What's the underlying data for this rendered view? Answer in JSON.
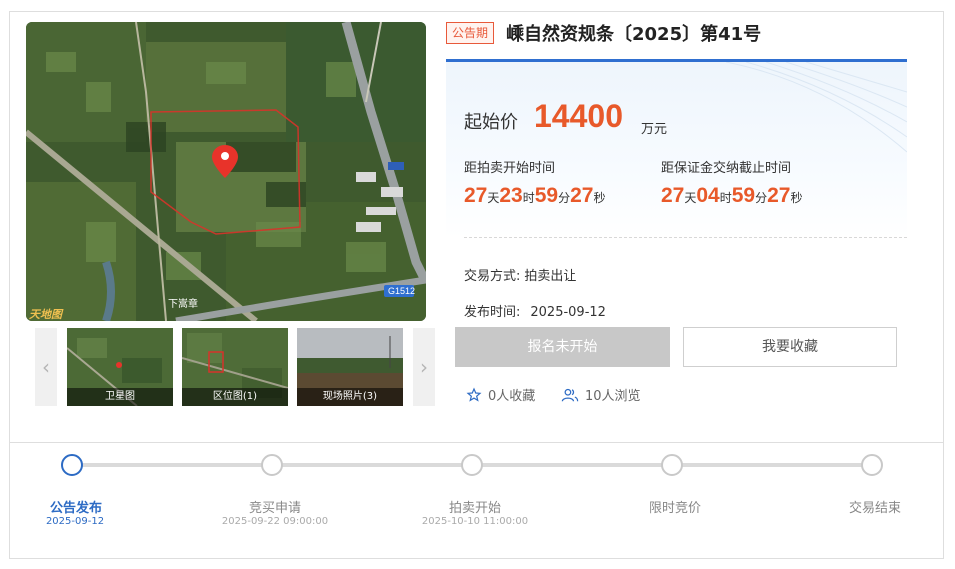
{
  "listing": {
    "badge": "公告期",
    "title": "嵊自然资规条〔2025〕第41号"
  },
  "map_labels": {
    "village": "下嵩章",
    "road": "G1512",
    "watermark": "天地图"
  },
  "thumbnails": [
    {
      "label": "卫星图"
    },
    {
      "label": "区位图(1)"
    },
    {
      "label": "现场照片(3)"
    }
  ],
  "price": {
    "label": "起始价",
    "value": "14400",
    "unit": "万元"
  },
  "countdowns": [
    {
      "label": "距拍卖开始时间",
      "days": "27",
      "hours": "23",
      "minutes": "59",
      "seconds": "27"
    },
    {
      "label": "距保证金交纳截止时间",
      "days": "27",
      "hours": "04",
      "minutes": "59",
      "seconds": "27"
    }
  ],
  "units": {
    "day": "天",
    "hour": "时",
    "minute": "分",
    "second": "秒"
  },
  "info": {
    "method_label": "交易方式:",
    "method_value": "拍卖出让",
    "published_label": "发布时间:",
    "published_value": "2025-09-12"
  },
  "buttons": {
    "register": "报名未开始",
    "favorite": "我要收藏"
  },
  "stats": {
    "favorites": "0人收藏",
    "views": "10人浏览"
  },
  "steps": [
    {
      "label": "公告发布",
      "date": "2025-09-12",
      "active": true
    },
    {
      "label": "竞买申请",
      "date": "2025-09-22 09:00:00",
      "active": false
    },
    {
      "label": "拍卖开始",
      "date": "2025-10-10 11:00:00",
      "active": false
    },
    {
      "label": "限时竞价",
      "date": "",
      "active": false
    },
    {
      "label": "交易结束",
      "date": "",
      "active": false
    }
  ],
  "colors": {
    "accent_blue": "#2d6bc4",
    "price_orange": "#e8592a",
    "badge_red": "#e8593a",
    "disabled_gray": "#c8c8c8"
  },
  "icons": {
    "prev": "chevron-left-icon",
    "next": "chevron-right-icon",
    "favorite": "star-icon",
    "views": "users-icon",
    "location": "map-pin-icon"
  }
}
